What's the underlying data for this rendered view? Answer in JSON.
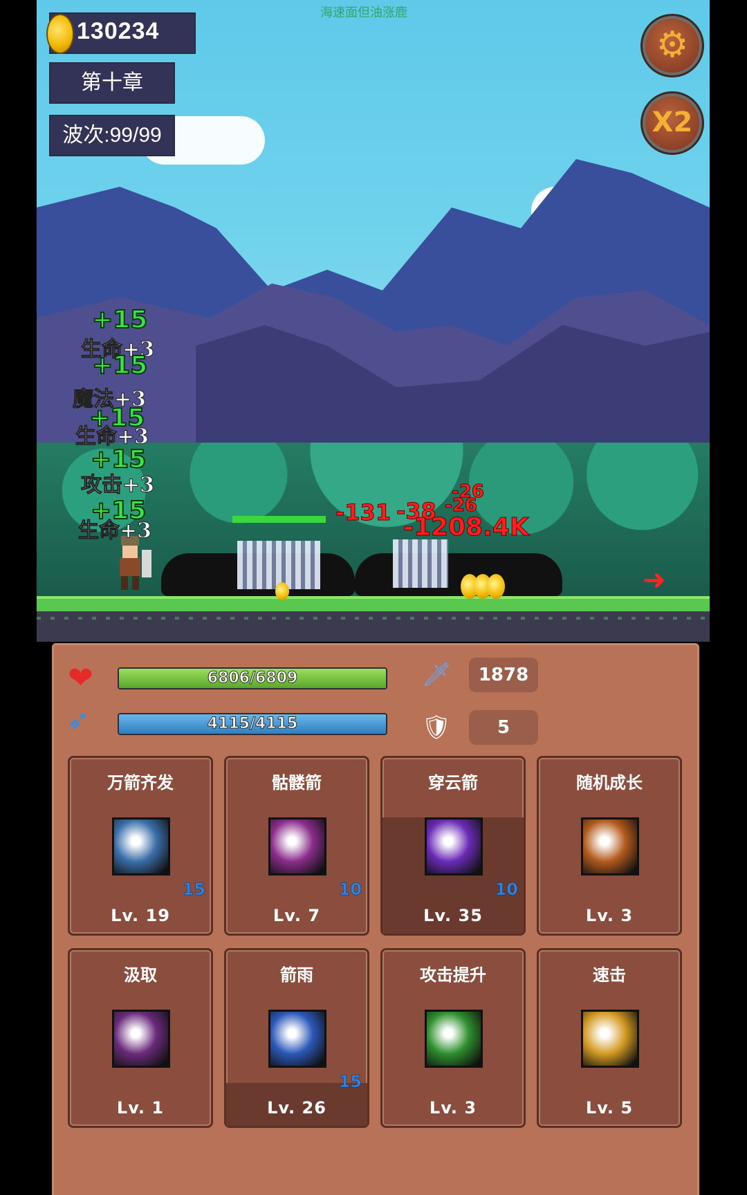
{
  "hud": {
    "gold": "130234",
    "chapter": "第十章",
    "wave": "波次:99/99",
    "watermark_text": "海速面但油涨鹿"
  },
  "buttons": {
    "settings_icon": "gear-icon",
    "speed_label": "X2"
  },
  "floating_text": {
    "heal": [
      "+15",
      "+15",
      "+15",
      "+15",
      "+15"
    ],
    "stat_gains": [
      "生命+3",
      "魔法+3",
      "生命+3",
      "攻击+3",
      "生命+3"
    ],
    "damage": [
      "-26",
      "-26",
      "-131",
      "-38",
      "-1208.4K"
    ]
  },
  "stats": {
    "hp": {
      "text": "6806/6809",
      "fill": 0.9996
    },
    "mp": {
      "text": "4115/4115",
      "fill": 1.0
    },
    "attack": "1878",
    "defense": "5"
  },
  "skills": [
    {
      "name": "万箭齐发",
      "level": "Lv. 19",
      "count": "15",
      "icon": "arrow-burst-icon",
      "color": "#3a6ea8"
    },
    {
      "name": "骷髅箭",
      "level": "Lv. 7",
      "count": "10",
      "icon": "skull-icon",
      "color": "#8a2d8a"
    },
    {
      "name": "穿云箭",
      "level": "Lv. 35",
      "count": "10",
      "icon": "piercing-arrow-icon",
      "color": "#6a2bb6"
    },
    {
      "name": "随机成长",
      "level": "Lv. 3",
      "count": "",
      "icon": "fist-icon",
      "color": "#b35a1c"
    },
    {
      "name": "汲取",
      "level": "Lv. 1",
      "count": "",
      "icon": "vortex-icon",
      "color": "#6a2a7a"
    },
    {
      "name": "箭雨",
      "level": "Lv. 26",
      "count": "15",
      "icon": "arrow-rain-icon",
      "color": "#2b58b8"
    },
    {
      "name": "攻击提升",
      "level": "Lv. 3",
      "count": "",
      "icon": "up-arrow-icon",
      "color": "#2e8f2e"
    },
    {
      "name": "速击",
      "level": "Lv. 5",
      "count": "",
      "icon": "quick-strike-icon",
      "color": "#d49a23"
    }
  ]
}
